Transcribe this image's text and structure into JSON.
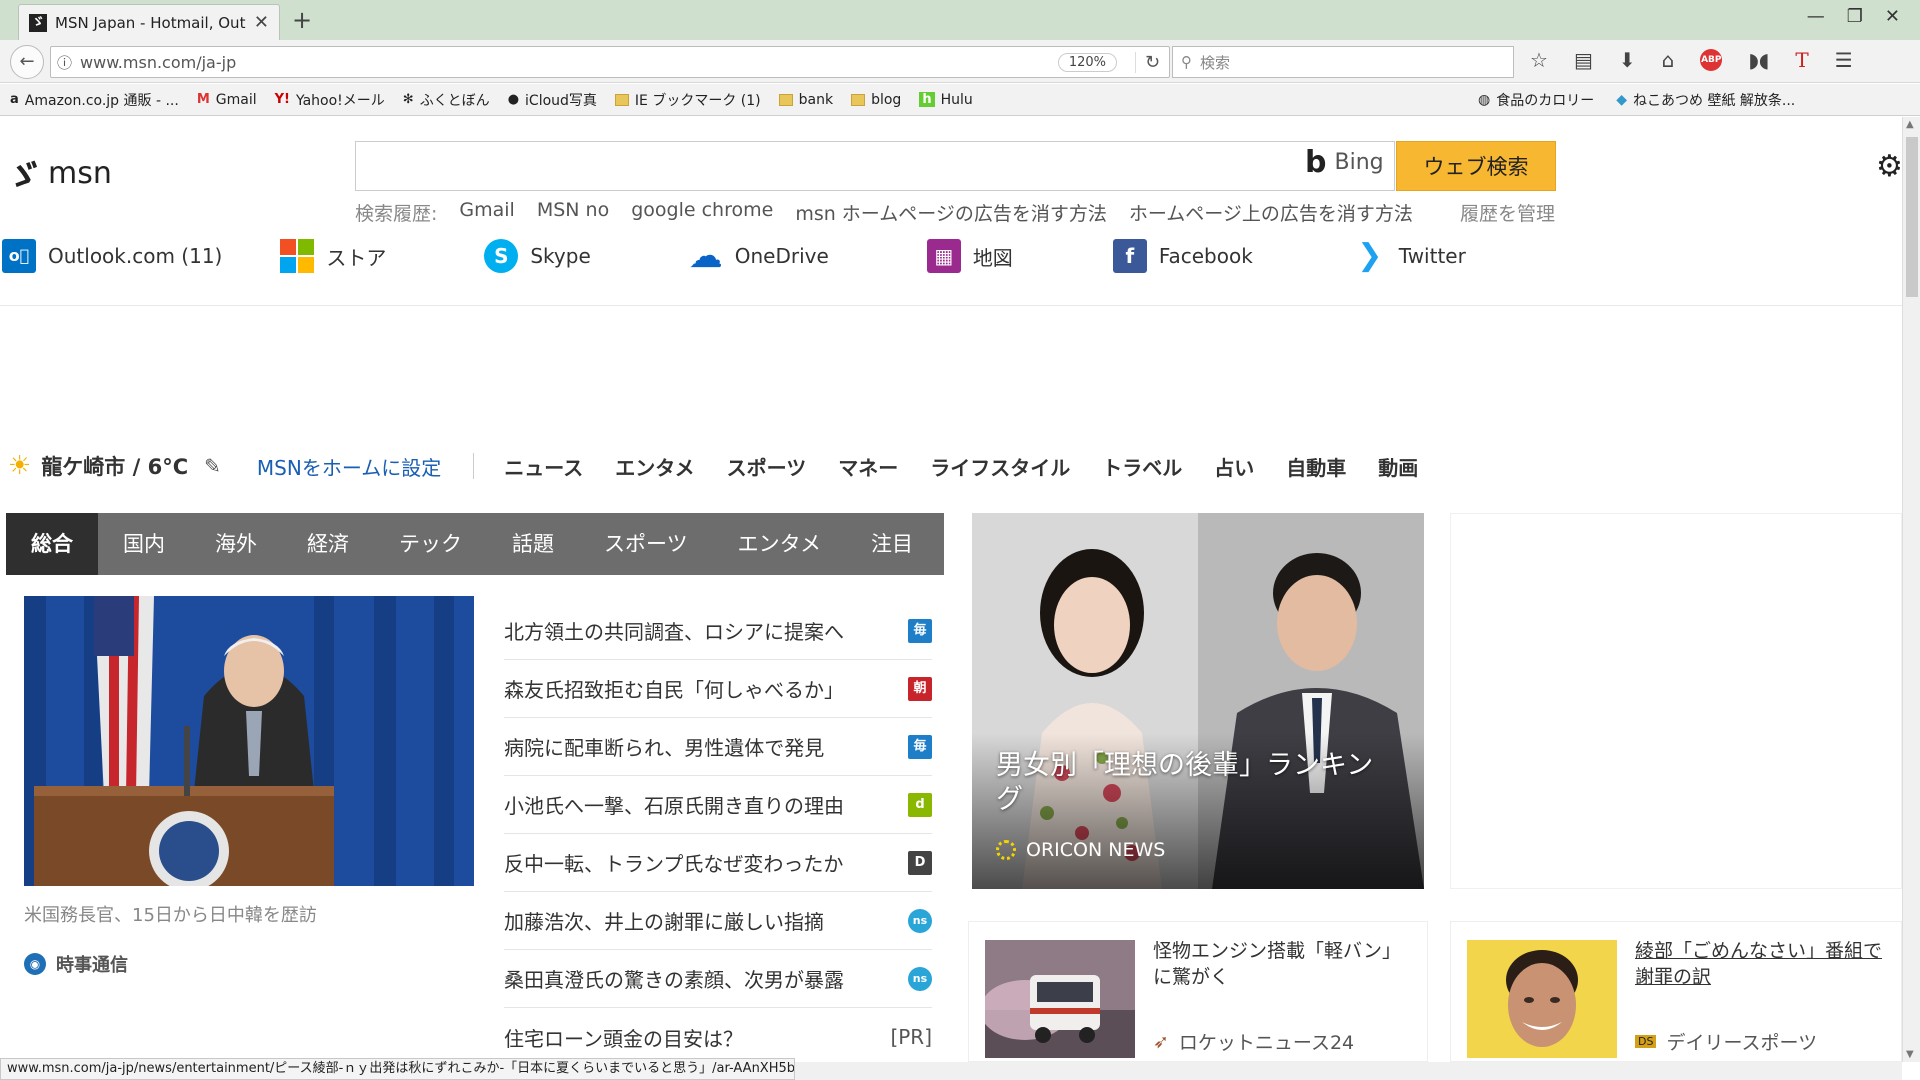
{
  "browser": {
    "tab_title": "MSN Japan - Hotmail, Out...",
    "tab_favicon": "msn-favicon",
    "url": "www.msn.com/ja-jp",
    "zoom": "120%",
    "search_placeholder": "検索",
    "status_url": "www.msn.com/ja-jp/news/entertainment/ピース綾部-ｎｙ出発は秋にずれこみか-「日本に夏くらいまでいると思う」/ar-AAnXH5b"
  },
  "bookmarks": [
    {
      "label": "Amazon.co.jp 通販 - ...",
      "icon": "a"
    },
    {
      "label": "Gmail",
      "icon": "M"
    },
    {
      "label": "Yahoo!メール",
      "icon": "Y!"
    },
    {
      "label": "ふくとぼん",
      "icon": "✻"
    },
    {
      "label": "iCloud写真",
      "icon": ""
    },
    {
      "label": "IE ブックマーク (1)",
      "icon": "folder"
    },
    {
      "label": "bank",
      "icon": "folder"
    },
    {
      "label": "blog",
      "icon": "folder"
    },
    {
      "label": "Hulu",
      "icon": "h"
    }
  ],
  "bookmarks_right": [
    {
      "label": "食品のカロリー"
    },
    {
      "label": "ねこあつめ 壁紙 解放条..."
    }
  ],
  "msn": {
    "logo": "msn",
    "bing_label": "Bing",
    "web_search_label": "ウェブ検索",
    "history_label": "検索履歴:",
    "history_items": [
      "Gmail",
      "MSN no",
      "google chrome",
      "msn ホームページの広告を消す方法",
      "ホームページ上の広告を消す方法"
    ],
    "manage_history": "履歴を管理"
  },
  "services": [
    {
      "label": "Outlook.com (11)",
      "color": "#0072c6",
      "glyph": "o"
    },
    {
      "label": "ストア",
      "color": "#f25022",
      "glyph": ""
    },
    {
      "label": "Skype",
      "color": "#00aff0",
      "glyph": "S"
    },
    {
      "label": "OneDrive",
      "color": "#0a64c8",
      "glyph": "☁"
    },
    {
      "label": "地図",
      "color": "#9b2a8f",
      "glyph": "▦"
    },
    {
      "label": "Facebook",
      "color": "#3b5998",
      "glyph": "f"
    },
    {
      "label": "Twitter",
      "color": "#1da1f2",
      "glyph": "🐦"
    }
  ],
  "info": {
    "weather": "龍ケ崎市 / 6°C",
    "set_home": "MSNをホームに設定",
    "categories": [
      "ニュース",
      "エンタメ",
      "スポーツ",
      "マネー",
      "ライフスタイル",
      "トラベル",
      "占い",
      "自動車",
      "動画"
    ]
  },
  "news_tabs": [
    "総合",
    "国内",
    "海外",
    "経済",
    "テック",
    "話題",
    "スポーツ",
    "エンタメ",
    "注目"
  ],
  "lead": {
    "caption": "米国務長官、15日から日中韓を歴訪",
    "source": "時事通信"
  },
  "headlines": [
    {
      "text": "北方領土の共同調査、ロシアに提案へ",
      "badge": "毎",
      "badge_color": "#1e7fc8"
    },
    {
      "text": "森友氏招致拒む自民「何しゃべるか」",
      "badge": "朝",
      "badge_color": "#c8242b"
    },
    {
      "text": "病院に配車断られ、男性遺体で発見",
      "badge": "毎",
      "badge_color": "#1e7fc8"
    },
    {
      "text": "小池氏へ一撃、石原氏開き直りの理由",
      "badge": "d",
      "badge_color": "#8ab800"
    },
    {
      "text": "反中一転、トランプ氏なぜ変わったか",
      "badge": "D",
      "badge_color": "#444444"
    },
    {
      "text": "加藤浩次、井上の謝罪に厳しい指摘",
      "badge": "ns",
      "badge_color": "#2aa5d8"
    },
    {
      "text": "桑田真澄氏の驚きの素顔、次男が暴露",
      "badge": "ns",
      "badge_color": "#2aa5d8"
    },
    {
      "text": "住宅ローン頭金の目安は？",
      "badge": "[PR]",
      "badge_color": ""
    }
  ],
  "feature": {
    "title": "男女別「理想の後輩」ランキング",
    "source": "ORICON NEWS"
  },
  "cards": [
    {
      "title": "怪物エンジン搭載「軽バン」に驚がく",
      "source": "ロケットニュース24"
    },
    {
      "title": "綾部「ごめんなさい」番組で謝罪の訳",
      "source": "デイリースポーツ"
    }
  ]
}
